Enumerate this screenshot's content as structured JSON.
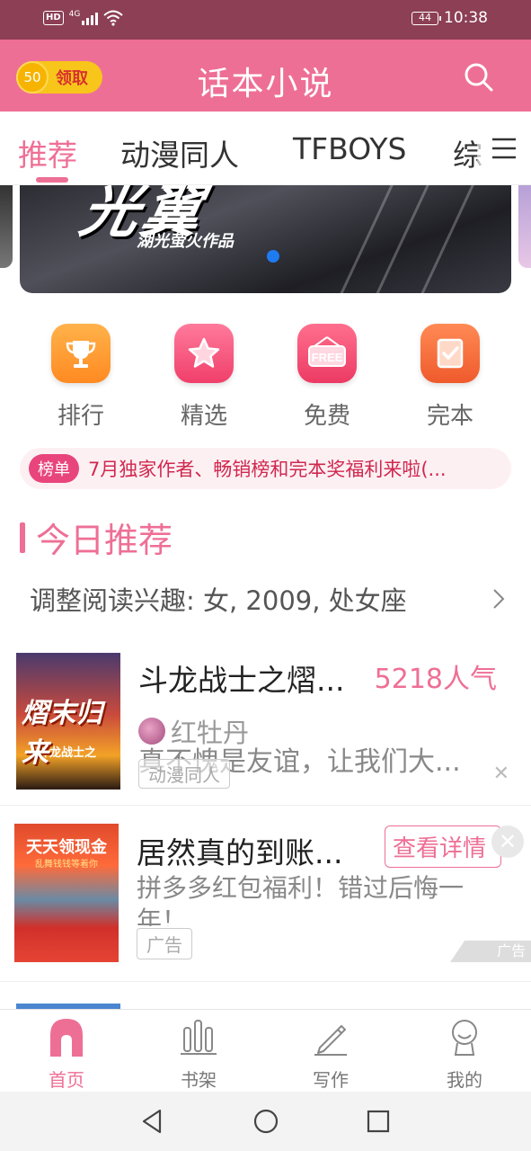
{
  "status_bar": {
    "hd": "HD",
    "network": "4G",
    "battery": "44",
    "time": "10:38"
  },
  "header": {
    "coin_value": "50",
    "coin_label": "领取",
    "title": "话本小说"
  },
  "tabs": [
    {
      "label": "推荐",
      "active": true
    },
    {
      "label": "动漫同人",
      "active": false
    },
    {
      "label": "TFBOYS",
      "active": false
    },
    {
      "label": "综",
      "active": false
    }
  ],
  "banner": {
    "art_text": "光翼",
    "sub_text": "湖光萤火作品"
  },
  "entries": [
    {
      "label": "排行",
      "icon": "trophy-icon",
      "color": "#ff9a2e"
    },
    {
      "label": "精选",
      "icon": "star-icon",
      "color": "#f2557c"
    },
    {
      "label": "免费",
      "icon": "free-sign-icon",
      "color": "#f04a6e"
    },
    {
      "label": "完本",
      "icon": "check-book-icon",
      "color": "#f36a3a"
    }
  ],
  "notice": {
    "badge": "榜单",
    "text": "7月独家作者、畅销榜和完本奖福利来啦(..."
  },
  "section": {
    "title": "今日推荐",
    "interest": "调整阅读兴趣: 女, 2009, 处女座"
  },
  "book": {
    "title": "斗龙战士之熠...",
    "popularity": "5218人气",
    "author": "红牡丹",
    "description": "真不愧是友谊，让我们大...",
    "tag": "动漫同人",
    "cover_title": "熠末归来",
    "cover_sub": "斗龙战士之"
  },
  "ad": {
    "title": "居然真的到账...",
    "button": "查看详情",
    "description": "拼多多红包福利！错过后悔一年！",
    "tag": "广告",
    "mark": "广告",
    "image_title": "天天领现金",
    "image_sub": "乱舞钱钱等着你"
  },
  "bottom_nav": [
    {
      "label": "首页",
      "icon": "home-icon",
      "active": true
    },
    {
      "label": "书架",
      "icon": "bookshelf-icon",
      "active": false
    },
    {
      "label": "写作",
      "icon": "pen-icon",
      "active": false
    },
    {
      "label": "我的",
      "icon": "profile-icon",
      "active": false
    }
  ],
  "colors": {
    "brand_pink": "#ee6f95",
    "status_bar": "#8c3f55",
    "coin_gold": "#f8c51b"
  }
}
